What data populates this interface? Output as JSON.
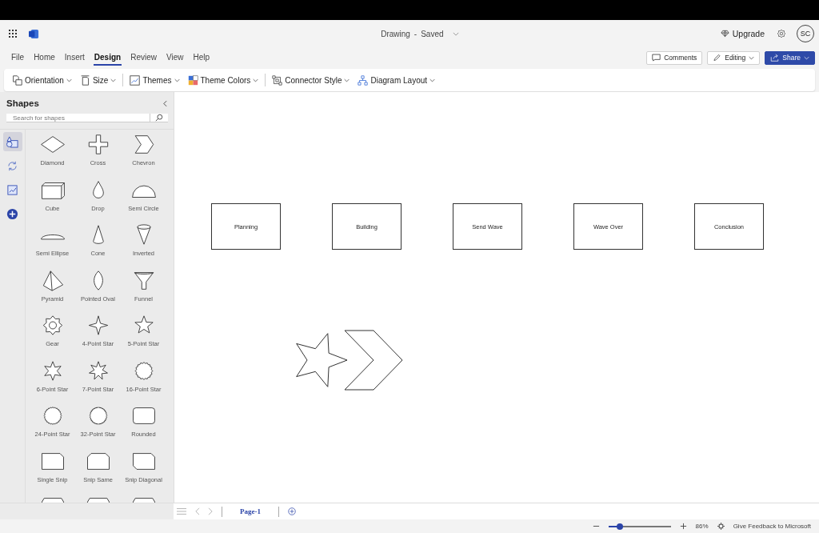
{
  "app_bar": {
    "document_title": "Drawing",
    "separator": "-",
    "save_state": "Saved",
    "upgrade": "Upgrade",
    "avatar_initials": "SC"
  },
  "menu_tabs": [
    {
      "label": "File",
      "selected": false
    },
    {
      "label": "Home",
      "selected": false
    },
    {
      "label": "Insert",
      "selected": false
    },
    {
      "label": "Design",
      "selected": true
    },
    {
      "label": "Review",
      "selected": false
    },
    {
      "label": "View",
      "selected": false
    },
    {
      "label": "Help",
      "selected": false
    }
  ],
  "actions": {
    "comments": "Comments",
    "editing": "Editing",
    "share": "Share"
  },
  "toolbar": [
    {
      "kind": "orientation",
      "label": "Orientation"
    },
    {
      "kind": "size",
      "label": "Size"
    },
    {
      "kind": "themes",
      "label": "Themes"
    },
    {
      "kind": "theme_colors",
      "label": "Theme Colors"
    },
    {
      "kind": "connector",
      "label": "Connector Style"
    },
    {
      "kind": "layout",
      "label": "Diagram Layout"
    }
  ],
  "shapes_panel": {
    "title": "Shapes",
    "search": {
      "placeholder": "Search for shapes"
    },
    "rail": [
      {
        "kind": "shapes",
        "selected": true
      },
      {
        "kind": "cycle",
        "selected": false
      },
      {
        "kind": "chart",
        "selected": false
      },
      {
        "kind": "add",
        "selected": false
      }
    ],
    "items": [
      {
        "kind": "diamond",
        "label": "Diamond"
      },
      {
        "kind": "cross",
        "label": "Cross"
      },
      {
        "kind": "chevron",
        "label": "Chevron"
      },
      {
        "kind": "cube",
        "label": "Cube"
      },
      {
        "kind": "drop",
        "label": "Drop"
      },
      {
        "kind": "semicircle",
        "label": "Semi Circle"
      },
      {
        "kind": "semiellipse",
        "label": "Semi Ellipse"
      },
      {
        "kind": "cone",
        "label": "Cone"
      },
      {
        "kind": "inverted",
        "label": "Inverted"
      },
      {
        "kind": "pyramid",
        "label": "Pyramid"
      },
      {
        "kind": "oval",
        "label": "Pointed Oval"
      },
      {
        "kind": "funnel",
        "label": "Funnel"
      },
      {
        "kind": "gear",
        "label": "Gear"
      },
      {
        "kind": "star4",
        "label": "4-Point Star"
      },
      {
        "kind": "star5",
        "label": "5-Point Star"
      },
      {
        "kind": "star6",
        "label": "6-Point Star"
      },
      {
        "kind": "star7",
        "label": "7-Point Star"
      },
      {
        "kind": "star16",
        "label": "16-Point Star"
      },
      {
        "kind": "star24",
        "label": "24-Point Star"
      },
      {
        "kind": "star32",
        "label": "32-Point Star"
      },
      {
        "kind": "rounded",
        "label": "Rounded"
      },
      {
        "kind": "snip1",
        "label": "Single Snip"
      },
      {
        "kind": "snipsame",
        "label": "Snip Same"
      },
      {
        "kind": "snipdiag",
        "label": "Snip Diagonal"
      },
      {
        "kind": "partial"
      },
      {
        "kind": "partial"
      },
      {
        "kind": "partial"
      }
    ]
  },
  "canvas": {
    "boxes": [
      {
        "label": "Planning"
      },
      {
        "label": "Building"
      },
      {
        "label": "Send Wave"
      },
      {
        "label": "Wave Over"
      },
      {
        "label": "Conclusion"
      }
    ],
    "shapes": [
      {
        "kind": "star5"
      },
      {
        "kind": "chevron"
      }
    ]
  },
  "page_tabs": [
    {
      "label": "Page-1",
      "selected": true
    }
  ],
  "status_bar": {
    "zoom": {
      "level": 0.19,
      "reading": "86%"
    },
    "feedback": "Give Feedback to Microsoft"
  }
}
